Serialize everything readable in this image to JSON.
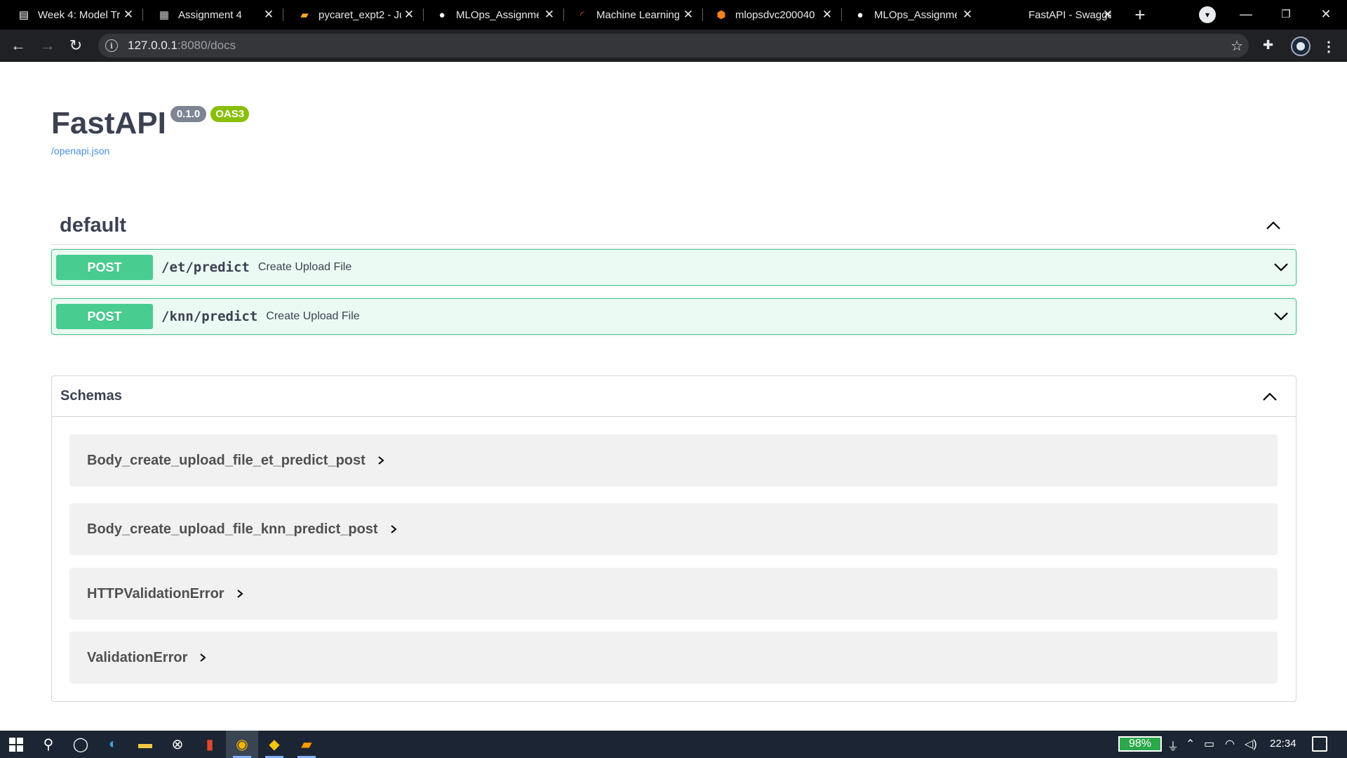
{
  "browser": {
    "tabs": [
      {
        "title": "Week 4: Model Tr",
        "icon": "document-icon"
      },
      {
        "title": "Assignment 4",
        "icon": "assignment-icon"
      },
      {
        "title": "pycaret_expt2 - Ju",
        "icon": "notebook-icon"
      },
      {
        "title": "MLOps_Assignme",
        "icon": "github-icon"
      },
      {
        "title": "Machine Learning",
        "icon": "loading-icon"
      },
      {
        "title": "mlopsdvc200040",
        "icon": "cube-icon"
      },
      {
        "title": "MLOps_Assignme",
        "icon": "github-icon"
      },
      {
        "title": "FastAPI - Swagge",
        "icon": "none"
      }
    ],
    "url_host": "127.0.0.1",
    "url_path": ":8080/docs"
  },
  "info": {
    "title": "FastAPI",
    "version": "0.1.0",
    "oas_badge": "OAS3",
    "spec_link": "/openapi.json"
  },
  "tag": {
    "name": "default",
    "operations": [
      {
        "method": "POST",
        "path": "/et/predict",
        "summary": "Create Upload File"
      },
      {
        "method": "POST",
        "path": "/knn/predict",
        "summary": "Create Upload File"
      }
    ]
  },
  "schemas": {
    "title": "Schemas",
    "models": [
      "Body_create_upload_file_et_predict_post",
      "Body_create_upload_file_knn_predict_post",
      "HTTPValidationError",
      "ValidationError"
    ]
  },
  "taskbar": {
    "battery": "98%",
    "time": "22:34"
  },
  "colors": {
    "post": "#49cc90",
    "version_badge": "#7d8492",
    "oas_badge": "#89bf04",
    "link": "#4990e2"
  }
}
